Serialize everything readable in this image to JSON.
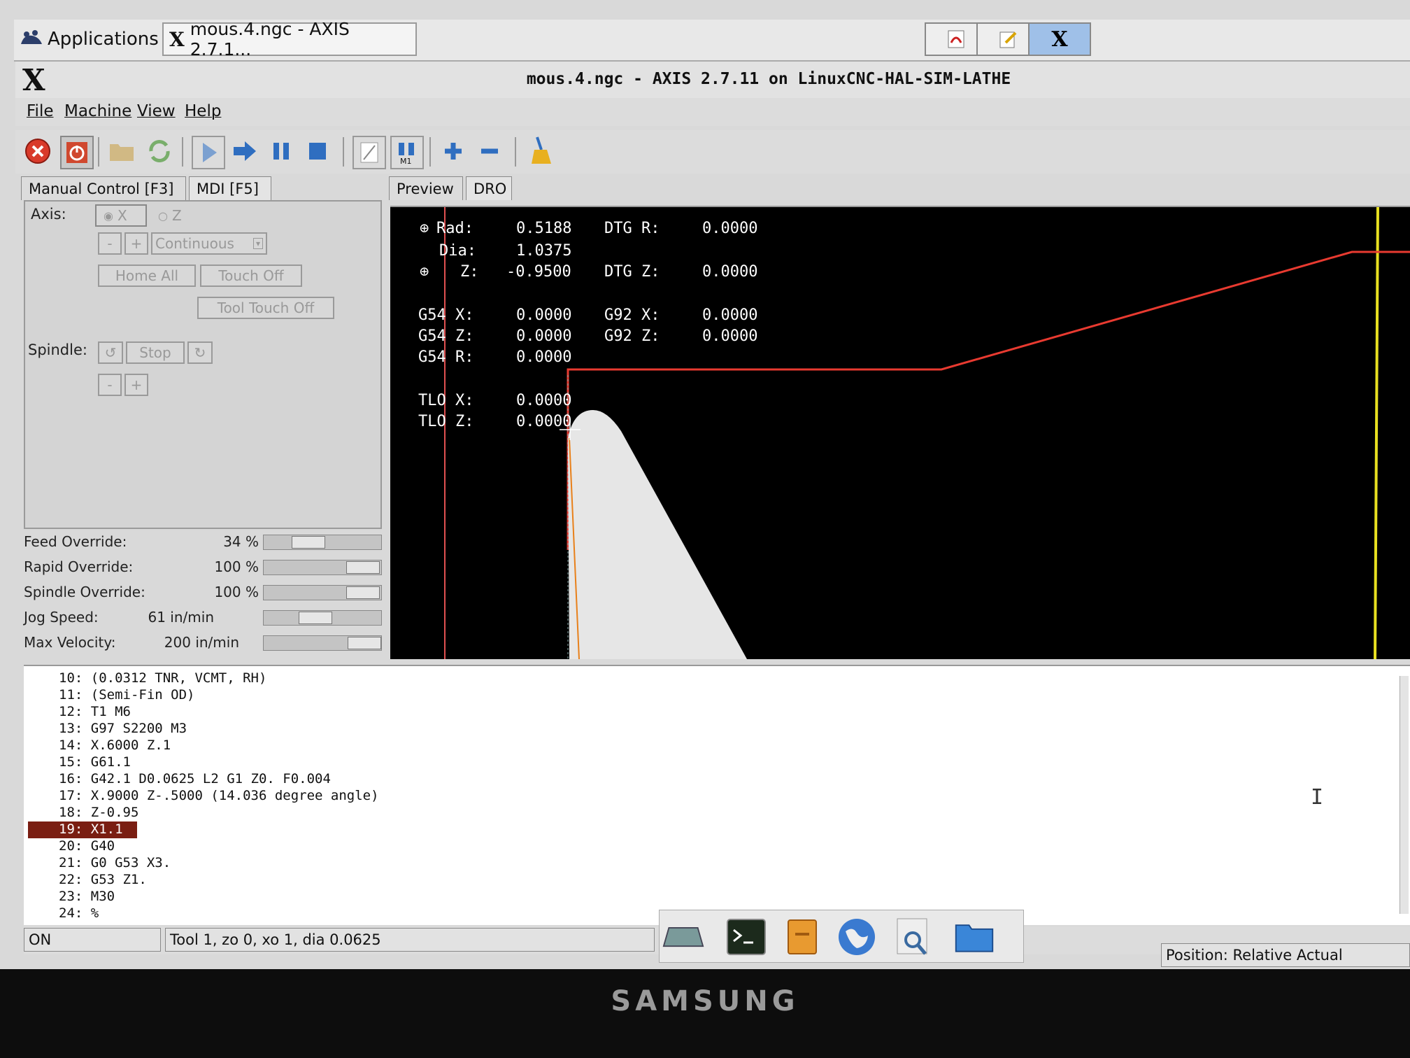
{
  "taskbar": {
    "applications_label": "Applications",
    "task_label": "mous.4.ngc - AXIS 2.7.1..."
  },
  "window": {
    "title": "mous.4.ngc - AXIS 2.7.11 on LinuxCNC-HAL-SIM-LATHE"
  },
  "menu": {
    "file": "File",
    "machine": "Machine",
    "view": "View",
    "help": "Help"
  },
  "left_tabs": {
    "manual": "Manual Control [F3]",
    "mdi": "MDI [F5]"
  },
  "manual": {
    "axis_label": "Axis:",
    "axis_x": "X",
    "axis_z": "Z",
    "minus": "-",
    "plus": "+",
    "jog_mode": "Continuous",
    "home_all": "Home All",
    "touch_off": "Touch Off",
    "tool_touch_off": "Tool Touch Off",
    "spindle_label": "Spindle:",
    "stop": "Stop"
  },
  "overrides": {
    "feed_label": "Feed Override:",
    "feed_value": "34 %",
    "feed_fraction": 0.34,
    "rapid_label": "Rapid Override:",
    "rapid_value": "100 %",
    "rapid_fraction": 1.0,
    "spindle_label": "Spindle Override:",
    "spindle_value": "100 %",
    "spindle_fraction": 1.0,
    "jog_label": "Jog Speed:",
    "jog_value": "61 in/min",
    "max_label": "Max Velocity:",
    "max_value": "200 in/min"
  },
  "preview_tabs": {
    "preview": "Preview",
    "dro": "DRO"
  },
  "dro": {
    "rad_label": "Rad:",
    "rad_value": "0.5188",
    "dtg_r_label": "DTG R:",
    "dtg_r_value": "0.0000",
    "dia_label": "Dia:",
    "dia_value": "1.0375",
    "z_label": "Z:",
    "z_value": "-0.9500",
    "dtg_z_label": "DTG Z:",
    "dtg_z_value": "0.0000",
    "g54x_label": "G54 X:",
    "g54x_value": "0.0000",
    "g92x_label": "G92 X:",
    "g92x_value": "0.0000",
    "g54z_label": "G54 Z:",
    "g54z_value": "0.0000",
    "g92z_label": "G92 Z:",
    "g92z_value": "0.0000",
    "g54r_label": "G54 R:",
    "g54r_value": "0.0000",
    "tlox_label": "TLO X:",
    "tlox_value": "0.0000",
    "tloz_label": "TLO Z:",
    "tloz_value": "0.0000"
  },
  "gcode": {
    "lines": [
      "10: (0.0312 TNR, VCMT, RH)",
      "11: (Semi-Fin OD)",
      "12: T1 M6",
      "13: G97 S2200 M3",
      "14: X.6000 Z.1",
      "15: G61.1",
      "16: G42.1 D0.0625 L2 G1 Z0. F0.004",
      "17: X.9000 Z-.5000 (14.036 degree angle)",
      "18: Z-0.95",
      "19: X1.1",
      "20: G40",
      "21: G0 G53 X3.",
      "22: G53 Z1.",
      "23: M30",
      "24: %"
    ],
    "current_index": 9
  },
  "status": {
    "state": "ON",
    "tool": "Tool 1, zo 0, xo 1, dia 0.0625",
    "position": "Position: Relative Actual"
  },
  "monitor": {
    "brand": "SAMSUNG"
  }
}
